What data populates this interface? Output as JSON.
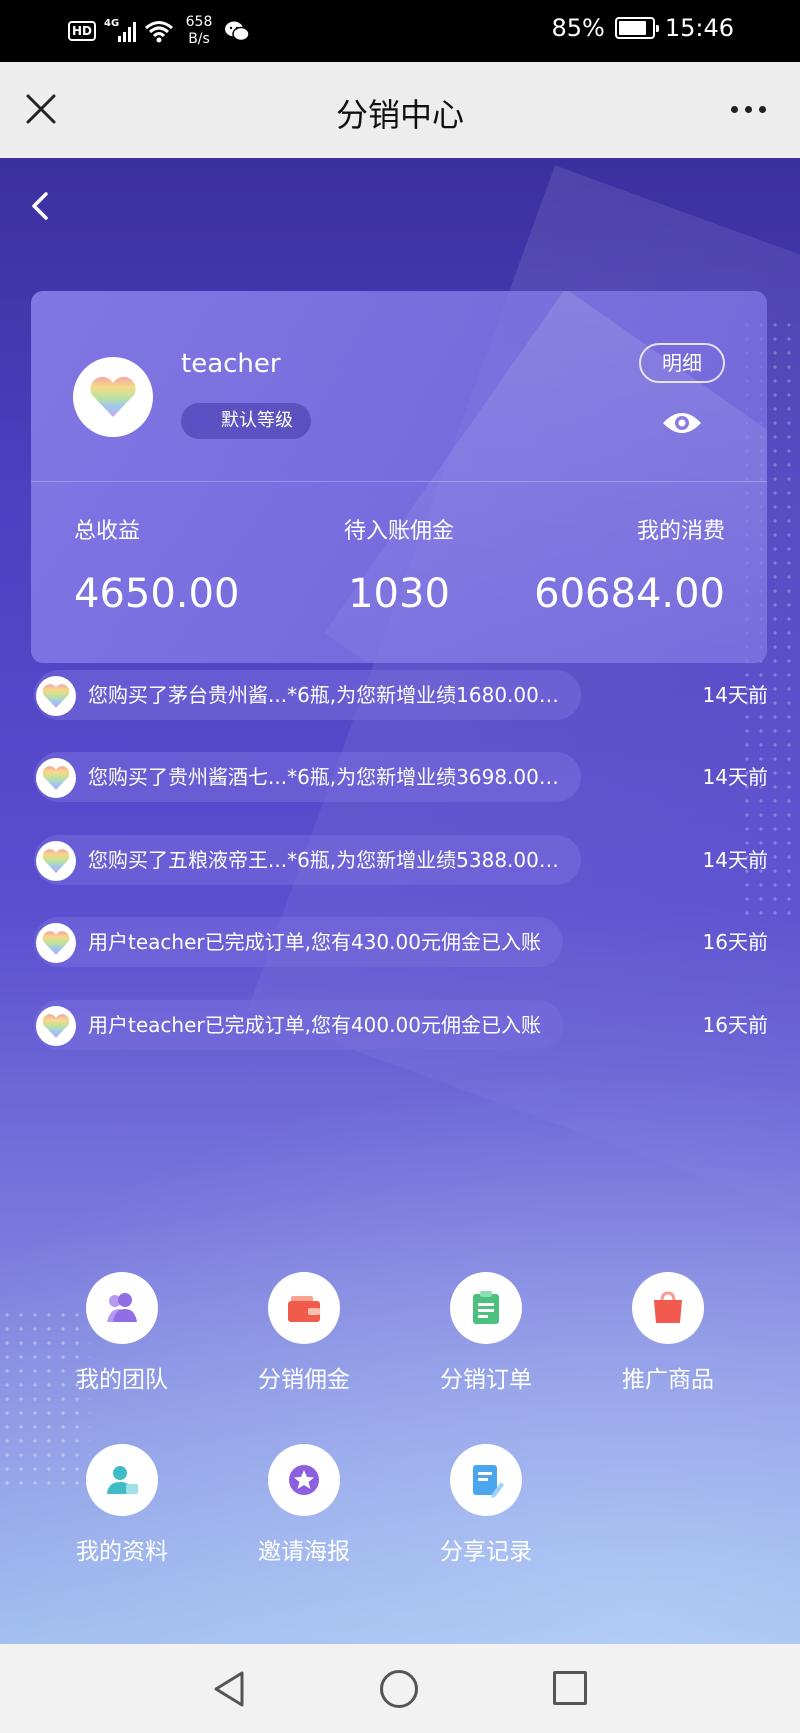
{
  "status_bar": {
    "hd": "HD",
    "network": "4G",
    "speed_value": "658",
    "speed_unit": "B/s",
    "battery": "85%",
    "battery_level": 0.85,
    "time": "15:46"
  },
  "title_bar": {
    "title": "分销中心"
  },
  "profile": {
    "username": "teacher",
    "level": "默认等级",
    "detail_label": "明细",
    "stats": [
      {
        "label": "总收益",
        "value": "4650.00"
      },
      {
        "label": "待入账佣金",
        "value": "1030"
      },
      {
        "label": "我的消费",
        "value": "60684.00"
      }
    ]
  },
  "feed": [
    {
      "text": "您购买了茅台贵州酱...*6瓶,为您新增业绩1680.00…",
      "time": "14天前"
    },
    {
      "text": "您购买了贵州酱酒七...*6瓶,为您新增业绩3698.00…",
      "time": "14天前"
    },
    {
      "text": "您购买了五粮液帝王...*6瓶,为您新增业绩5388.00…",
      "time": "14天前"
    },
    {
      "text": "用户teacher已完成订单,您有430.00元佣金已入账",
      "time": "16天前"
    },
    {
      "text": "用户teacher已完成订单,您有400.00元佣金已入账",
      "time": "16天前"
    }
  ],
  "menu": [
    {
      "label": "我的团队",
      "icon": "team-icon",
      "color": "#8f6ee6"
    },
    {
      "label": "分销佣金",
      "icon": "wallet-icon",
      "color": "#f05b4b"
    },
    {
      "label": "分销订单",
      "icon": "clipboard-icon",
      "color": "#4cc07f"
    },
    {
      "label": "推广商品",
      "icon": "shopping-bag-icon",
      "color": "#f35a4f"
    },
    {
      "label": "我的资料",
      "icon": "profile-icon",
      "color": "#3fbcc8"
    },
    {
      "label": "邀请海报",
      "icon": "star-badge-icon",
      "color": "#8c5fe0"
    },
    {
      "label": "分享记录",
      "icon": "record-icon",
      "color": "#4aa7ee"
    }
  ]
}
